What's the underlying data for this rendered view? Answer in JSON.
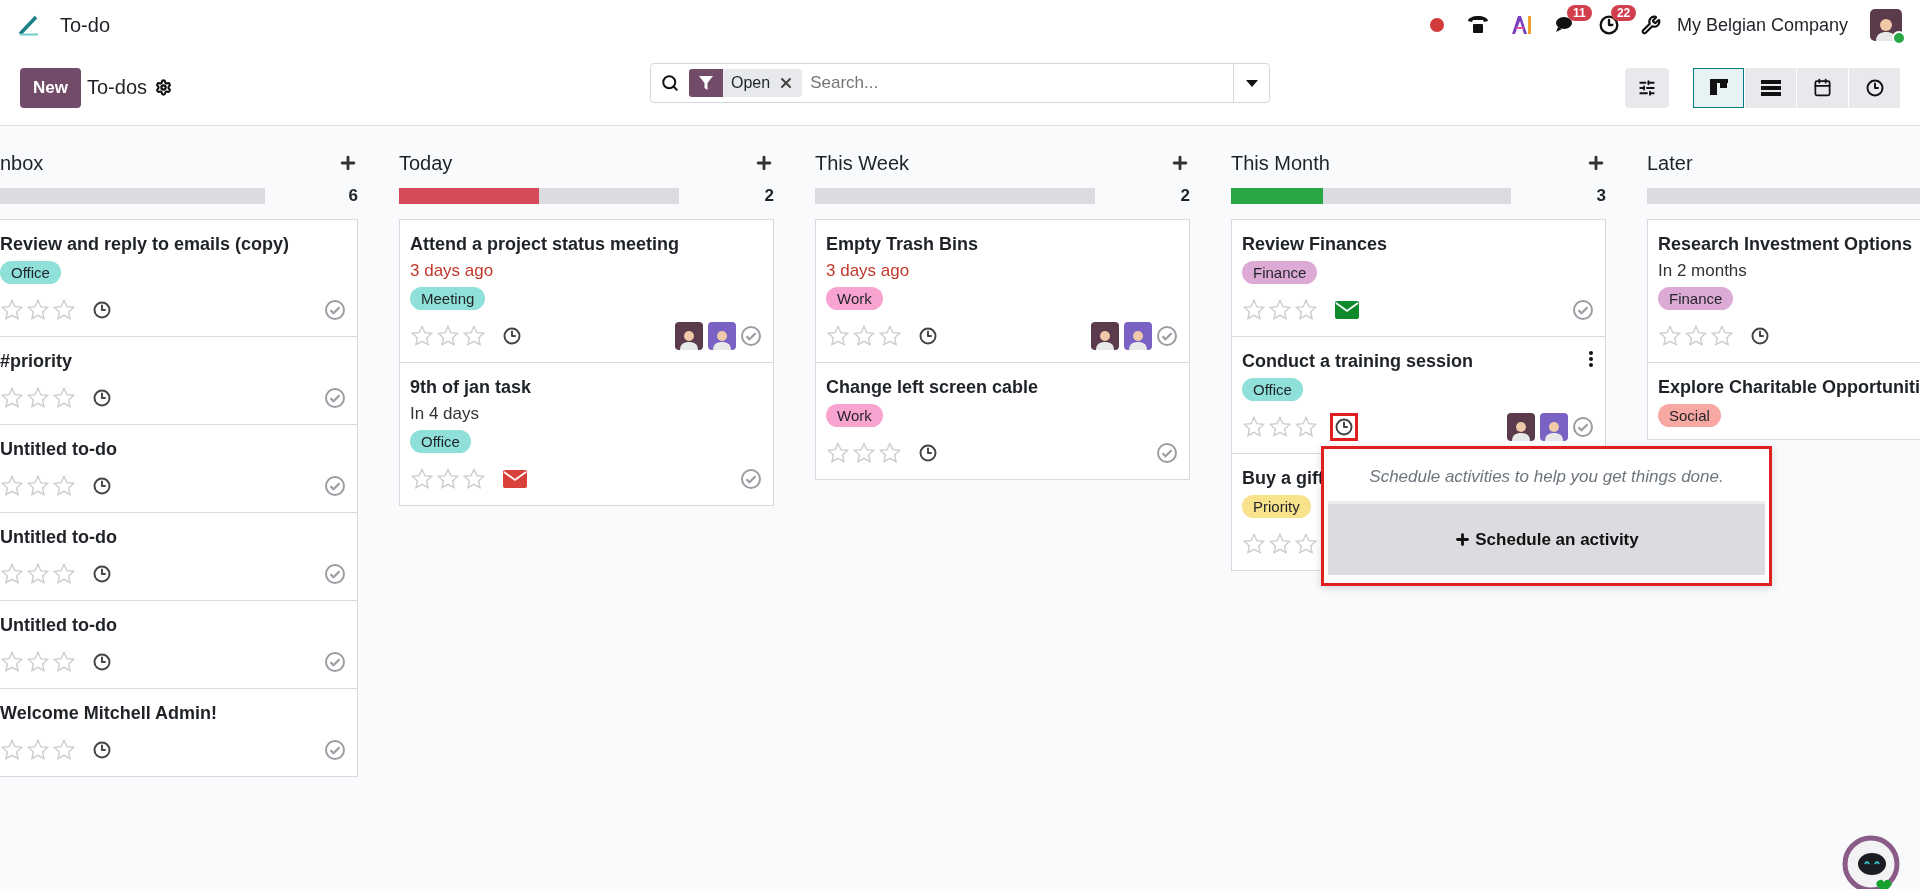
{
  "navbar": {
    "app_title": "To-do",
    "chat_badge": "11",
    "activity_badge": "22",
    "company": "My Belgian Company",
    "user_online": true
  },
  "control_panel": {
    "new_button": "New",
    "breadcrumb": "To-dos",
    "search": {
      "facet": "Open",
      "placeholder": "Search..."
    },
    "views": [
      {
        "kind": "kanban",
        "selected": true
      },
      {
        "kind": "list",
        "selected": false
      },
      {
        "kind": "calendar",
        "selected": false
      },
      {
        "kind": "activity",
        "selected": false
      }
    ]
  },
  "columns": [
    {
      "title": "nbox",
      "count": "6",
      "cards": [
        {
          "title": "Review and reply to emails (copy)",
          "tags": [
            {
              "label": "Office",
              "color": "#8ee0d8"
            }
          ],
          "stars": 0,
          "activity": {
            "kind": "clock"
          }
        },
        {
          "title": "#priority",
          "stars": 0,
          "activity": {
            "kind": "clock"
          }
        },
        {
          "title": "Untitled to-do",
          "stars": 0,
          "activity": {
            "kind": "clock"
          }
        },
        {
          "title": "Untitled to-do",
          "stars": 0,
          "activity": {
            "kind": "clock"
          }
        },
        {
          "title": "Untitled to-do",
          "stars": 0,
          "activity": {
            "kind": "clock"
          }
        },
        {
          "title": "Welcome Mitchell Admin!",
          "stars": 0,
          "activity": {
            "kind": "clock"
          }
        }
      ]
    },
    {
      "title": "Today",
      "count": "2",
      "progress": {
        "level": 0.5,
        "color": "#d44c59"
      },
      "cards": [
        {
          "title": "Attend a project status meeting",
          "date": "3 days ago",
          "overdue": true,
          "tags": [
            {
              "label": "Meeting",
              "color": "#8ee0d8"
            }
          ],
          "stars": 0,
          "activity": {
            "kind": "clock"
          },
          "assignees": [
            {
              "color": "#5b3a4c"
            },
            {
              "color": "#7a62c4"
            }
          ]
        },
        {
          "title": "9th of jan task",
          "date": "In 4 days",
          "overdue": false,
          "tags": [
            {
              "label": "Office",
              "color": "#8ee0d8"
            }
          ],
          "stars": 0,
          "activity": {
            "kind": "mail",
            "overdue": true
          }
        }
      ]
    },
    {
      "title": "This Week",
      "count": "2",
      "cards": [
        {
          "title": "Empty Trash Bins",
          "date": "3 days ago",
          "overdue": true,
          "tags": [
            {
              "label": "Work",
              "color": "#f9a3d0"
            }
          ],
          "stars": 0,
          "activity": {
            "kind": "clock"
          },
          "assignees": [
            {
              "color": "#5b3a4c"
            },
            {
              "color": "#7a62c4"
            }
          ]
        },
        {
          "title": "Change left screen cable",
          "tags": [
            {
              "label": "Work",
              "color": "#f9a3d0"
            }
          ],
          "stars": 0,
          "activity": {
            "kind": "clock"
          }
        }
      ]
    },
    {
      "title": "This Month",
      "count": "3",
      "progress": {
        "level": 0.33,
        "color": "#28a745"
      },
      "cards": [
        {
          "title": "Review Finances",
          "tags": [
            {
              "label": "Finance",
              "color": "#dcaad4"
            }
          ],
          "stars": 0,
          "activity": {
            "kind": "mail",
            "overdue": false
          }
        },
        {
          "title": "Conduct a training session",
          "menu": true,
          "tags": [
            {
              "label": "Office",
              "color": "#8ee0d8"
            }
          ],
          "stars": 0,
          "activity": {
            "kind": "clock",
            "highlighted": true
          },
          "assignees": [
            {
              "color": "#5b3a4c"
            },
            {
              "color": "#7a62c4"
            }
          ]
        },
        {
          "title": "Buy a gift",
          "tags": [
            {
              "label": "Priority",
              "color": "#f9e28c"
            }
          ],
          "stars": 0
        }
      ]
    },
    {
      "title": "Later",
      "cards": [
        {
          "title": "Research Investment Options",
          "date": "In 2 months",
          "overdue": false,
          "tags": [
            {
              "label": "Finance",
              "color": "#dcaad4"
            }
          ],
          "stars": 0,
          "activity": {
            "kind": "clock"
          }
        },
        {
          "title": "Explore Charitable Opportuniti",
          "tags": [
            {
              "label": "Social",
              "color": "#f8a8a3"
            }
          ]
        }
      ]
    }
  ],
  "activity_popover": {
    "message": "Schedule activities to help you get things done.",
    "button": "Schedule an activity"
  }
}
